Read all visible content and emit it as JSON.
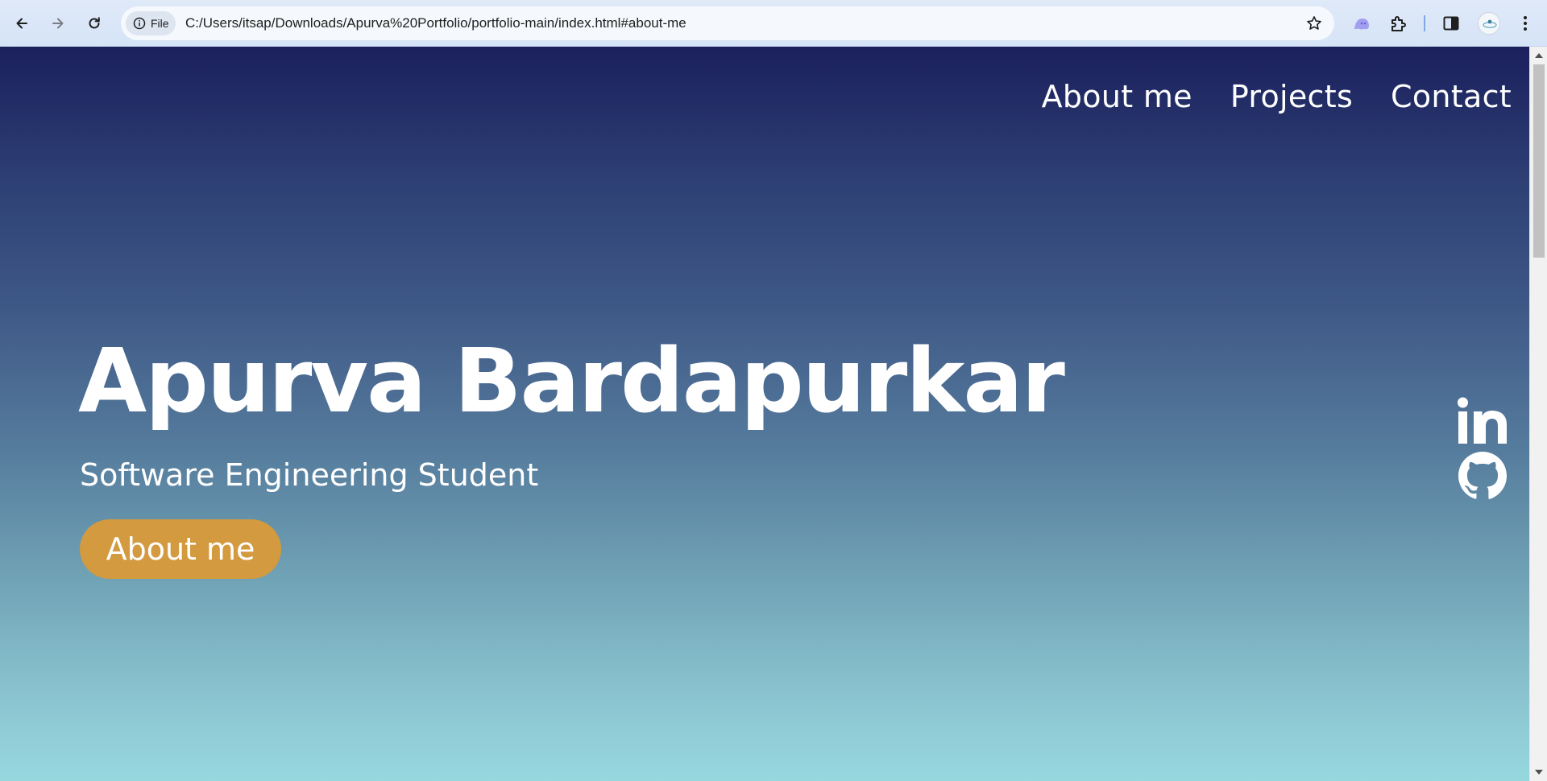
{
  "browser": {
    "site_chip_label": "File",
    "url": "C:/Users/itsap/Downloads/Apurva%20Portfolio/portfolio-main/index.html#about-me",
    "icons": {
      "back": "arrow-left-icon",
      "forward": "arrow-right-icon",
      "reload": "reload-icon",
      "site_info": "info-icon",
      "bookmark": "star-icon",
      "extension_ghost": "ghost-extension-icon",
      "extensions": "puzzle-icon",
      "side_panel": "side-panel-icon",
      "profile": "avatar",
      "menu": "kebab-menu-icon"
    },
    "colors": {
      "chrome_bg": "#d6e4f7",
      "omnibox_bg": "#f5f8fc",
      "separator": "#7da7e6",
      "ghost_icon": "#a29ef0"
    }
  },
  "page": {
    "nav": [
      {
        "label": "About me"
      },
      {
        "label": "Projects"
      },
      {
        "label": "Contact"
      }
    ],
    "hero": {
      "name": "Apurva Bardapurkar",
      "subtitle": "Software Engineering Student",
      "cta_label": "About me"
    },
    "social": [
      {
        "icon": "linkedin-icon"
      },
      {
        "icon": "github-icon"
      }
    ],
    "colors": {
      "gradient_top": "#1b205c",
      "gradient_bottom": "#97d8df",
      "cta_bg": "#d39a3f",
      "text": "#ffffff"
    }
  }
}
